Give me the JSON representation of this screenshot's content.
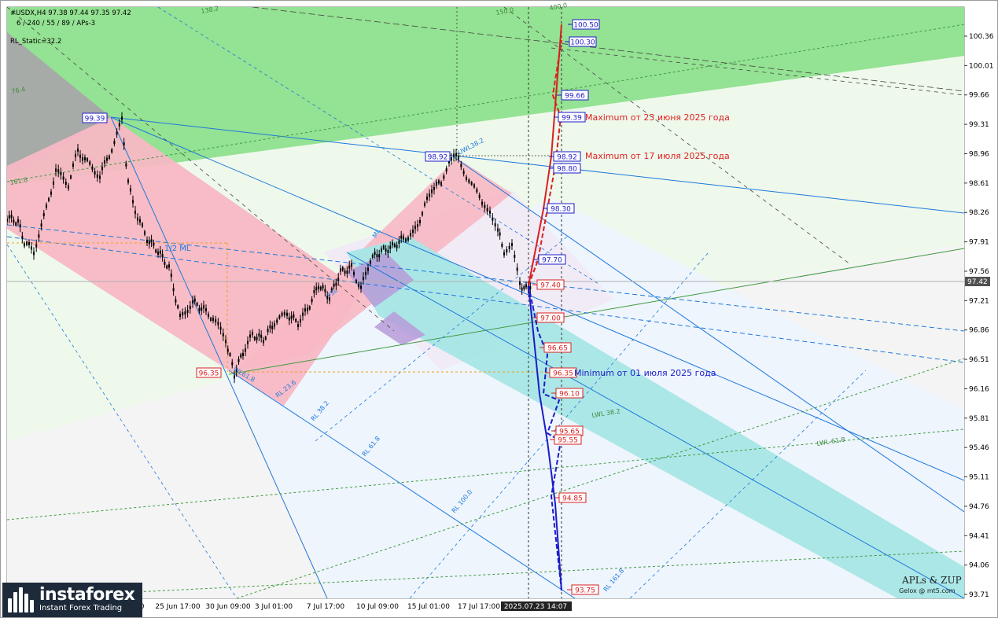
{
  "header": {
    "symbol_line": "#USDX,H4  97.38 97.44 97.35 97.42",
    "params_line": "6 / 240 / 55 / 89 / APs-3",
    "rl_static": "RL_Static=32.2"
  },
  "chart_data": {
    "type": "line",
    "title": "#USDX,H4",
    "ohlc_last": {
      "open": 97.38,
      "high": 97.44,
      "low": 97.35,
      "close": 97.42
    },
    "ylim": [
      93.71,
      100.5
    ],
    "y_ticks": [
      100.36,
      100.01,
      99.66,
      99.31,
      98.96,
      98.61,
      98.26,
      97.91,
      97.56,
      97.21,
      96.86,
      96.51,
      96.16,
      95.81,
      95.46,
      95.11,
      94.76,
      94.41,
      94.06,
      93.71
    ],
    "current_price": "97.42",
    "x_ticks": [
      "25 Jun 17:00",
      "30 Jun 09:00",
      "3 Jul 01:00",
      "7 Jul 17:00",
      "10 Jul 09:00",
      "15 Jul 01:00",
      "17 Jul 17:00",
      "2025.07.23 14:07"
    ],
    "x_partial_tick": ":00",
    "price_path": [
      [
        0,
        98.2
      ],
      [
        14,
        98.15
      ],
      [
        22,
        97.9
      ],
      [
        34,
        97.8
      ],
      [
        50,
        98.3
      ],
      [
        62,
        98.75
      ],
      [
        78,
        98.6
      ],
      [
        90,
        99.0
      ],
      [
        102,
        98.85
      ],
      [
        118,
        98.7
      ],
      [
        130,
        98.95
      ],
      [
        146,
        99.35
      ],
      [
        154,
        98.6
      ],
      [
        166,
        98.2
      ],
      [
        178,
        97.95
      ],
      [
        192,
        97.8
      ],
      [
        206,
        97.6
      ],
      [
        220,
        97.0
      ],
      [
        236,
        97.2
      ],
      [
        250,
        97.1
      ],
      [
        262,
        97.0
      ],
      [
        278,
        96.75
      ],
      [
        289,
        96.33
      ],
      [
        300,
        96.6
      ],
      [
        312,
        96.8
      ],
      [
        326,
        96.75
      ],
      [
        340,
        96.95
      ],
      [
        356,
        97.05
      ],
      [
        370,
        96.95
      ],
      [
        382,
        97.1
      ],
      [
        396,
        97.4
      ],
      [
        410,
        97.25
      ],
      [
        424,
        97.55
      ],
      [
        438,
        97.6
      ],
      [
        450,
        97.35
      ],
      [
        462,
        97.7
      ],
      [
        476,
        97.8
      ],
      [
        490,
        97.85
      ],
      [
        504,
        97.95
      ],
      [
        516,
        98.0
      ],
      [
        528,
        98.25
      ],
      [
        540,
        98.55
      ],
      [
        552,
        98.6
      ],
      [
        562,
        98.9
      ],
      [
        574,
        98.92
      ],
      [
        584,
        98.7
      ],
      [
        594,
        98.55
      ],
      [
        604,
        98.35
      ],
      [
        614,
        98.3
      ],
      [
        624,
        98.05
      ],
      [
        632,
        97.8
      ],
      [
        642,
        97.85
      ],
      [
        652,
        97.4
      ],
      [
        660,
        97.35
      ],
      [
        668,
        97.42
      ]
    ],
    "price_labels": [
      {
        "label": "100.50",
        "value": 100.5,
        "color": "blue"
      },
      {
        "label": "100.30",
        "value": 100.3,
        "color": "blue"
      },
      {
        "label": "99.66",
        "value": 99.66,
        "color": "blue"
      },
      {
        "label": "99.39",
        "value": 99.39,
        "color": "blue"
      },
      {
        "label": "98.92",
        "value": 98.92,
        "color": "blue"
      },
      {
        "label": "98.80",
        "value": 98.8,
        "color": "blue"
      },
      {
        "label": "98.30",
        "value": 98.3,
        "color": "blue"
      },
      {
        "label": "97.70",
        "value": 97.7,
        "color": "blue"
      },
      {
        "label": "97.40",
        "value": 97.4,
        "color": "red"
      },
      {
        "label": "97.00",
        "value": 97.0,
        "color": "red"
      },
      {
        "label": "96.65",
        "value": 96.65,
        "color": "red"
      },
      {
        "label": "96.35",
        "value": 96.35,
        "color": "red"
      },
      {
        "label": "96.10",
        "value": 96.1,
        "color": "red"
      },
      {
        "label": "95.65",
        "value": 95.65,
        "color": "red"
      },
      {
        "label": "95.55",
        "value": 95.55,
        "color": "red"
      },
      {
        "label": "94.85",
        "value": 94.85,
        "color": "red"
      },
      {
        "label": "93.75",
        "value": 93.75,
        "color": "red"
      }
    ],
    "swing_labels": [
      {
        "label": "99.39",
        "value": 99.39,
        "color": "blue"
      },
      {
        "label": "98.92",
        "value": 98.92,
        "color": "blue"
      },
      {
        "label": "96.35",
        "value": 96.35,
        "color": "red"
      }
    ],
    "bullish_scenario": [
      97.42,
      97.7,
      98.3,
      98.8,
      98.92,
      99.39,
      99.66,
      100.3,
      100.5
    ],
    "bearish_scenario": [
      97.42,
      97.0,
      96.35,
      95.55,
      94.85,
      93.75
    ],
    "annotations": [
      {
        "text": "Maximum от 23 июня 2025 года",
        "color": "#e02020"
      },
      {
        "text": "Maximum от 17 июля 2025 года",
        "color": "#e02020"
      },
      {
        "text": "Minimum от 01 июля 2025 года",
        "color": "#1c1cc8"
      }
    ],
    "level_labels": [
      "1/2 ML",
      "UWL38.2",
      "WL61.8",
      "RL 23.6",
      "RL 38.2",
      "RL 61.8",
      "RL 100.0",
      "RL 161.8",
      "LWL 38.2",
      "LWL 61.8",
      "ML",
      "FSL",
      "161.8",
      "76.4",
      "138.2",
      "150.0",
      "400.0",
      "100.0",
      "61.8"
    ],
    "grid": false
  },
  "watermark": {
    "title": "APLs & ZUP",
    "credit": "Gelox @ mt5.com"
  },
  "logo": {
    "brand": "instaforex",
    "tagline": "Instant Forex Trading"
  },
  "colors": {
    "green_zone": "#8ee08e",
    "pink_zone": "#f7b8c4",
    "cyan_zone": "#a6e6e6",
    "blue_line": "#1e78dc",
    "red_line": "#d82020",
    "dark_blue": "#1c1cc8"
  }
}
